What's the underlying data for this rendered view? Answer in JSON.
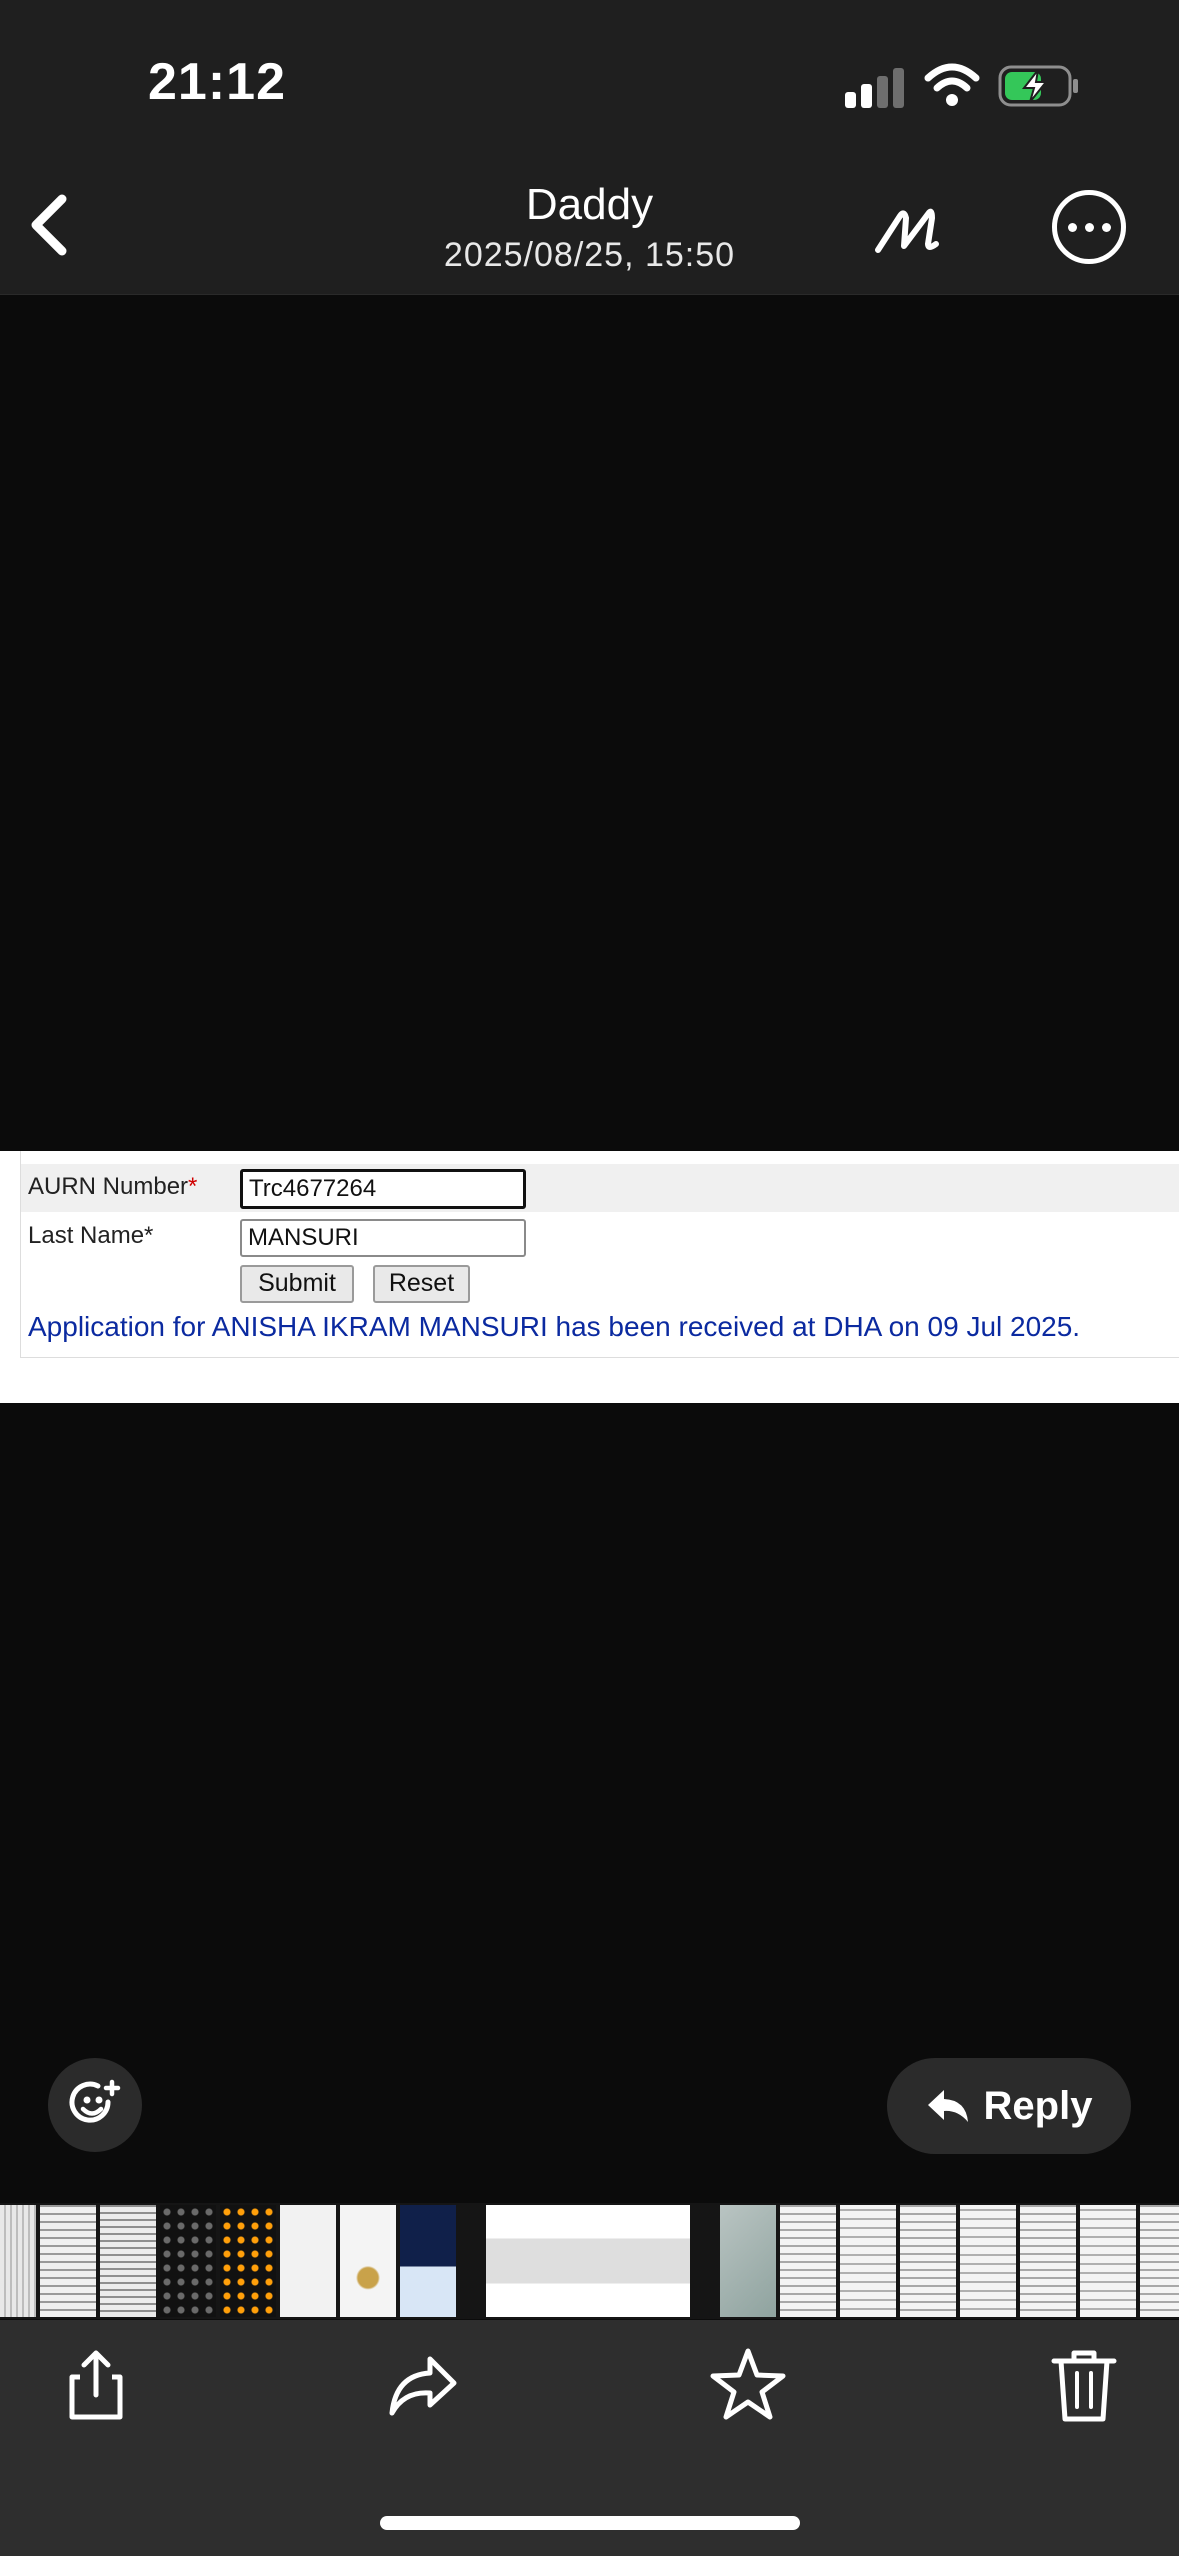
{
  "status_bar": {
    "time": "21:12",
    "battery_state": "charging"
  },
  "header": {
    "title": "Daddy",
    "date": "2025/08/25, 15:50"
  },
  "photo": {
    "aurn_label": "AURN Number",
    "aurn_required": "*",
    "aurn_value": "Trc4677264",
    "lastname_label": "Last Name*",
    "lastname_value": "MANSURI",
    "submit_label": "Submit",
    "reset_label": "Reset",
    "result_message": "Application for ANISHA IKRAM MANSURI has been received at DHA on 09 Jul 2025."
  },
  "actions": {
    "reply_label": "Reply"
  },
  "icons": {
    "back": "chevron-left-icon",
    "markup": "markup-pen-icon",
    "more": "ellipsis-circle-icon",
    "reaction": "add-reaction-icon",
    "reply": "reply-arrow-icon",
    "share": "share-icon",
    "forward": "forward-icon",
    "favorite": "star-icon",
    "delete": "trash-icon"
  },
  "colors": {
    "header_bg": "#1f1f1f",
    "viewer_bg": "#0b0b0b",
    "toolbar_bg": "#2e2e2e",
    "battery_fill": "#34c759",
    "result_text": "#0b2aa0"
  }
}
